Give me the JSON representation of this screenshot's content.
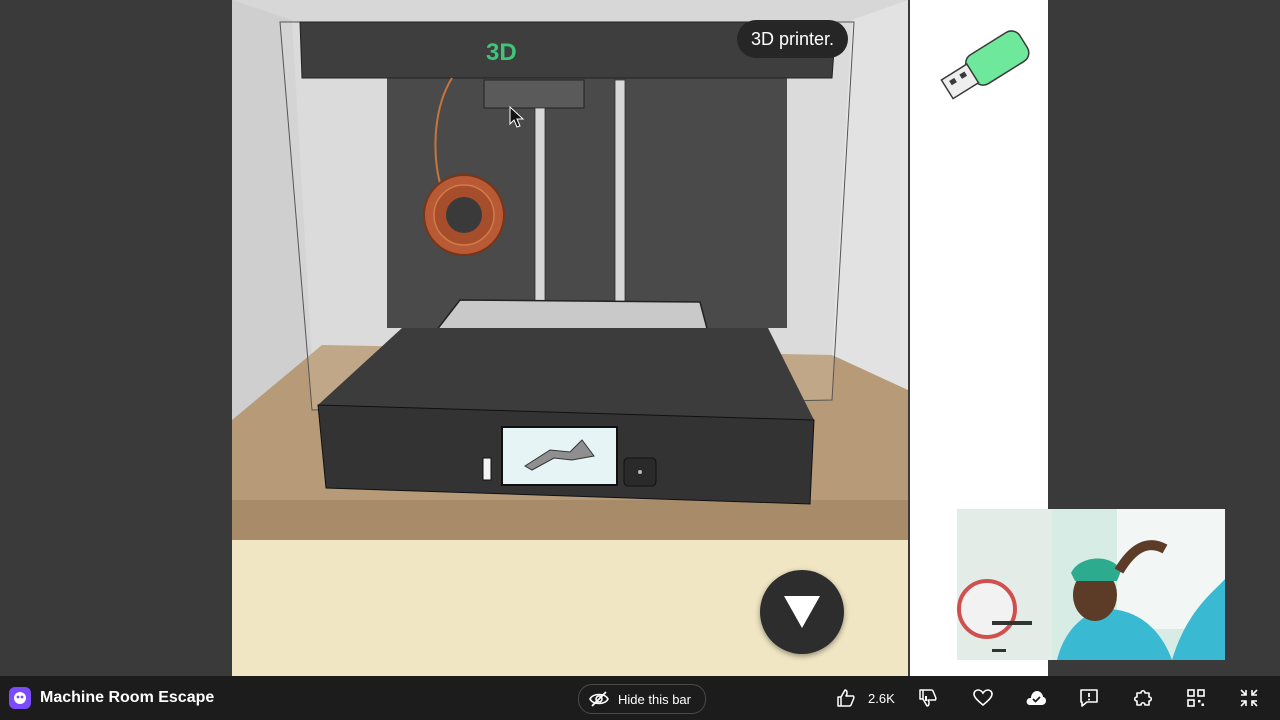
{
  "game": {
    "title": "Machine Room Escape"
  },
  "scene": {
    "tooltip": "3D printer.",
    "printer_brand_fragment": "3D"
  },
  "inventory": {
    "items": [
      {
        "icon": "usb-drive-icon",
        "color": "#6ee89a"
      }
    ]
  },
  "bottom_bar": {
    "hide_label": "Hide this bar",
    "like_count": "2.6K",
    "buttons": [
      "like-icon",
      "dislike-icon",
      "heart-icon",
      "cloud-save-icon",
      "report-icon",
      "puzzle-icon",
      "qr-code-icon",
      "exit-fullscreen-icon"
    ]
  },
  "colors": {
    "accent": "#7a4bff",
    "printer_screen_text": "#3fc47a",
    "bar_bg": "#1c1c1c"
  }
}
